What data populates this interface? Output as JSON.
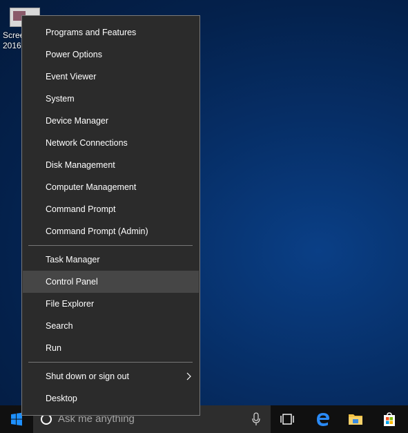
{
  "desktop": {
    "icon_label": "Scree\n2016-"
  },
  "context_menu": {
    "group1": [
      {
        "label": "Programs and Features"
      },
      {
        "label": "Power Options"
      },
      {
        "label": "Event Viewer"
      },
      {
        "label": "System"
      },
      {
        "label": "Device Manager"
      },
      {
        "label": "Network Connections"
      },
      {
        "label": "Disk Management"
      },
      {
        "label": "Computer Management"
      },
      {
        "label": "Command Prompt"
      },
      {
        "label": "Command Prompt (Admin)"
      }
    ],
    "group2": [
      {
        "label": "Task Manager"
      },
      {
        "label": "Control Panel",
        "highlighted": true
      },
      {
        "label": "File Explorer"
      },
      {
        "label": "Search"
      },
      {
        "label": "Run"
      }
    ],
    "group3": [
      {
        "label": "Shut down or sign out",
        "has_submenu": true
      },
      {
        "label": "Desktop"
      }
    ]
  },
  "taskbar": {
    "search_placeholder": "Ask me anything",
    "icons": [
      "windows-start-icon",
      "cortana-circle-icon",
      "microphone-icon",
      "task-view-icon",
      "edge-browser-icon",
      "file-explorer-icon",
      "store-icon"
    ]
  },
  "colors": {
    "menu_bg": "#2b2b2b",
    "menu_highlight": "#464646",
    "taskbar_bg": "#101010",
    "accent": "#1e90ff"
  }
}
